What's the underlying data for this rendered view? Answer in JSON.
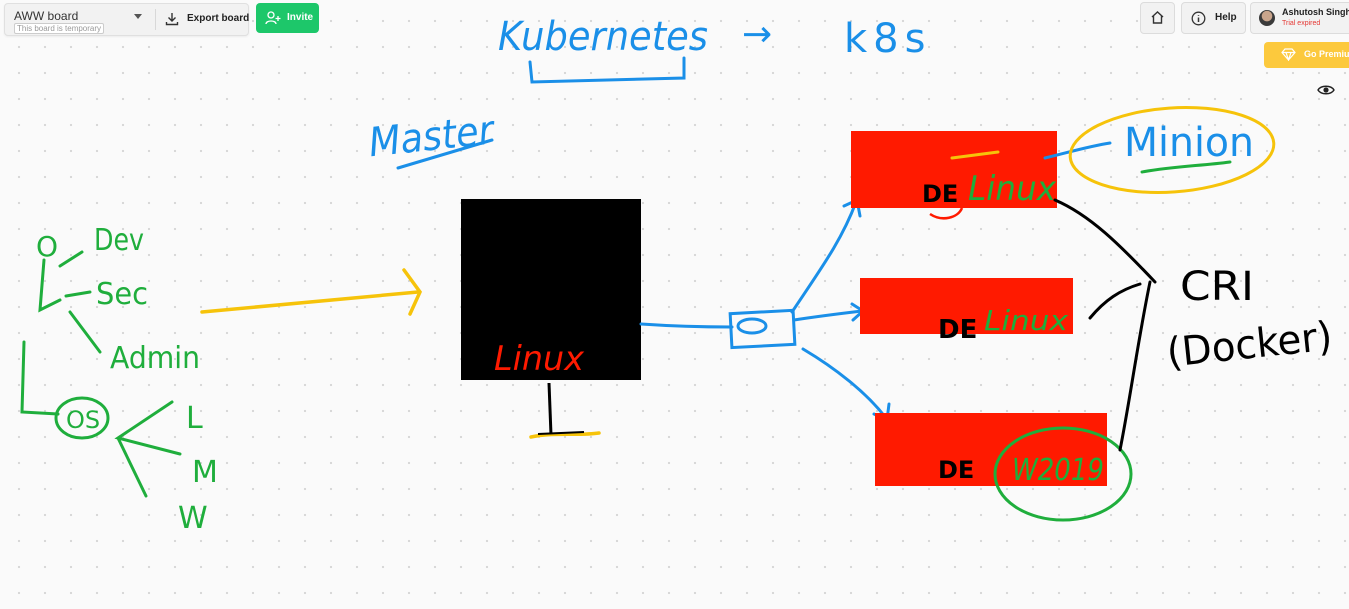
{
  "toolbar": {
    "board_name": "AWW board",
    "board_temp_note": "This board is temporary",
    "export_label": "Export board",
    "invite_label": "Invite"
  },
  "topright": {
    "help_label": "Help",
    "user_name": "Ashutosh Singh",
    "user_status": "Trial expired",
    "premium_label": "Go Premium"
  },
  "canvas": {
    "title_left": "Kubernetes",
    "title_arrow": "→",
    "title_right": "k8s",
    "master_label": "Master",
    "master_os": "Linux",
    "nodes": [
      {
        "prefix": "DE",
        "os": "Linux"
      },
      {
        "prefix": "DE",
        "os": "Linux"
      },
      {
        "prefix": "DE",
        "os": "W2019"
      }
    ],
    "minion_label": "Minion",
    "cri_label": "CRI",
    "cri_sub": "(Docker)",
    "left_tree": {
      "root": "O",
      "branches": [
        "Dev",
        "Sec",
        "Admin"
      ],
      "os": "OS",
      "os_branches": [
        "L",
        "M",
        "W"
      ]
    }
  },
  "colors": {
    "blue": "#1a8fe8",
    "green": "#1fae3c",
    "red": "#ff1a00",
    "yellow": "#f6c30a",
    "black": "#000000",
    "accent_green": "#1dc76a",
    "premium": "#fcc93d"
  },
  "icons": [
    "chevron-down-icon",
    "download-icon",
    "add-user-icon",
    "home-icon",
    "info-icon",
    "diamond-icon",
    "eye-icon"
  ]
}
